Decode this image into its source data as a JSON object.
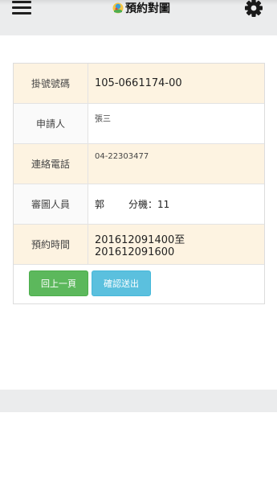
{
  "header": {
    "title": "預約對圖",
    "menu_icon": "hamburger-menu-icon",
    "settings_icon": "gear-icon",
    "logo_icon": "app-logo-icon"
  },
  "form": {
    "rows": [
      {
        "label": "掛號號碼",
        "value": "105-0661174-00"
      },
      {
        "label": "申請人",
        "value": "張三"
      },
      {
        "label": "連絡電話",
        "value": "04-22303477"
      },
      {
        "label": "審圖人員",
        "value_name": "郭",
        "value_ext": "分機：11"
      },
      {
        "label": "預約時間",
        "value": "201612091400至201612091600"
      }
    ],
    "row_colors": {
      "odd": "#fdf3e1",
      "even": "#ffffff"
    }
  },
  "buttons": {
    "back_label": "回上一頁",
    "back_color": "#5cb85c",
    "submit_label": "確認送出",
    "submit_color": "#5bc0de"
  }
}
